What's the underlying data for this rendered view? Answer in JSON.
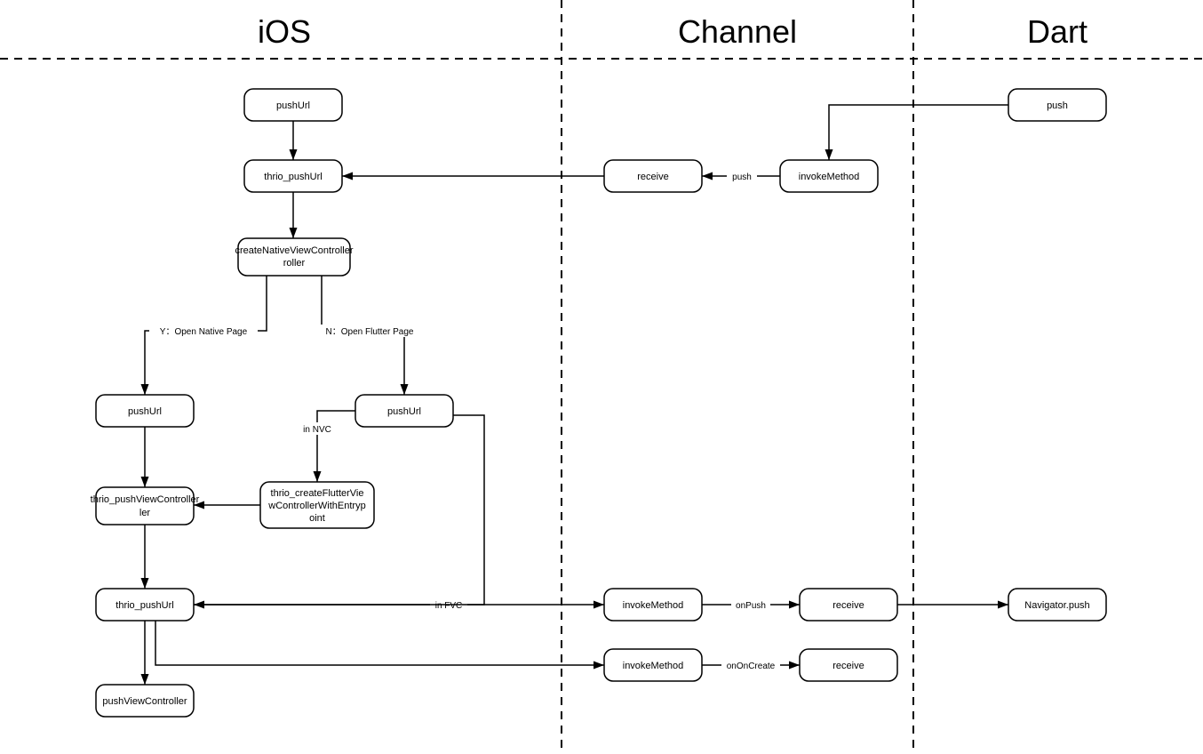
{
  "sections": {
    "ios": "iOS",
    "channel": "Channel",
    "dart": "Dart"
  },
  "nodes": {
    "n1": "pushUrl",
    "n2": "thrio_pushUrl",
    "n3": "createNativeViewController",
    "n3_l2": "roller",
    "n4": "pushUrl",
    "n5": "pushUrl",
    "n6": "thrio_pushViewController",
    "n6_l2": "ler",
    "n7": "thrio_createFlutterVie",
    "n7_l2": "wControllerWithEntryp",
    "n7_l3": "oint",
    "n8": "thrio_pushUrl",
    "n9": "pushViewController",
    "c1": "receive",
    "c2": "invokeMethod",
    "c3": "invokeMethod",
    "c4": "receive",
    "c5": "invokeMethod",
    "c6": "receive",
    "d1": "push",
    "d2": "Navigator.push"
  },
  "edges": {
    "yNative": "Y：Open Native Page",
    "nFlutter": "N：Open Flutter Page",
    "inNVC": "in NVC",
    "inFVC": "in FVC",
    "pushLbl": "push",
    "onPush": "onPush",
    "onOnCreate": "onOnCreate"
  }
}
